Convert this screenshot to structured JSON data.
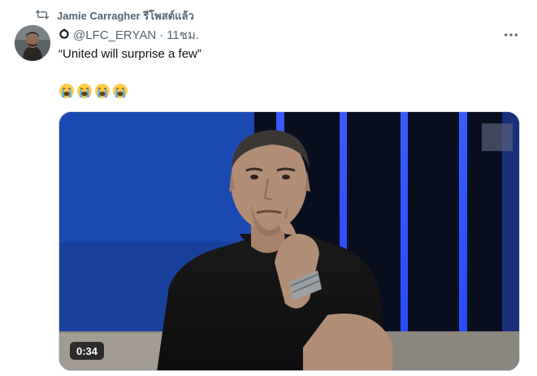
{
  "repost": {
    "text": "Jamie Carragher รีโพสต์แล้ว",
    "icon": "repost-icon"
  },
  "tweet": {
    "handle": "@LFC_ERYAN",
    "separator": "·",
    "time": "11ชม.",
    "text": "“United will surprise a few”",
    "emojis": [
      "loudly-crying-face",
      "loudly-crying-face",
      "loudly-crying-face",
      "loudly-crying-face"
    ],
    "more_icon": "more-icon"
  },
  "video": {
    "duration": "0:34"
  },
  "colors": {
    "secondary_text": "#536471",
    "primary_text": "#0f1419",
    "border": "#cfd9de",
    "stage_blue": "#1e56d6"
  }
}
